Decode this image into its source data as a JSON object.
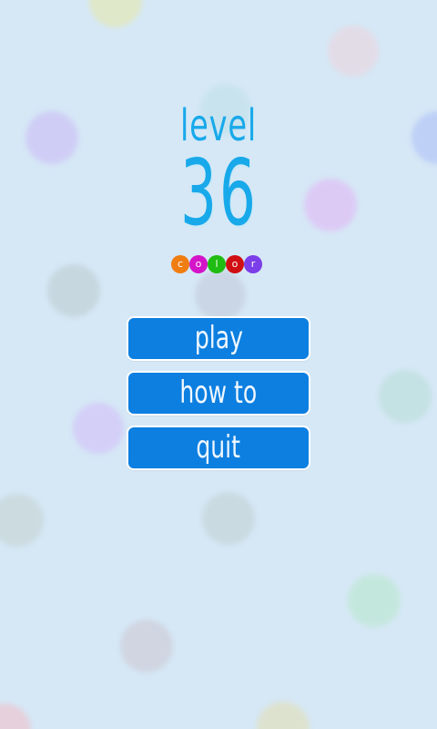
{
  "colors": {
    "background": "#d6e8f6",
    "logo_text": "#18a9ea",
    "button_fill": "#0d7fe0",
    "button_border": "#ffffff",
    "button_text": "#f1f8ff"
  },
  "background_bubbles": [
    {
      "color": "#dfe8c8"
    },
    {
      "color": "#e2dce7"
    },
    {
      "color": "#c8e3ee"
    },
    {
      "color": "#cfcdf5"
    },
    {
      "color": "#bed0f6"
    },
    {
      "color": "#dccaf5"
    },
    {
      "color": "#c7d7df"
    },
    {
      "color": "#cad6e5"
    },
    {
      "color": "#d3cff7"
    },
    {
      "color": "#c4e1e3"
    },
    {
      "color": "#cbdbe0"
    },
    {
      "color": "#cadae1"
    },
    {
      "color": "#c4e7dd"
    },
    {
      "color": "#d0d5e1"
    },
    {
      "color": "#e5d0db"
    },
    {
      "color": "#dde2cf"
    }
  ],
  "logo": {
    "word": "level",
    "number": "36"
  },
  "color_dots": [
    {
      "letter": "c",
      "color": "#f07d10"
    },
    {
      "letter": "o",
      "color": "#d414c8"
    },
    {
      "letter": "l",
      "color": "#1fbc11"
    },
    {
      "letter": "o",
      "color": "#d00f12"
    },
    {
      "letter": "r",
      "color": "#7b3ee9"
    }
  ],
  "menu": {
    "play_label": "play",
    "howto_label": "how to",
    "quit_label": "quit"
  }
}
